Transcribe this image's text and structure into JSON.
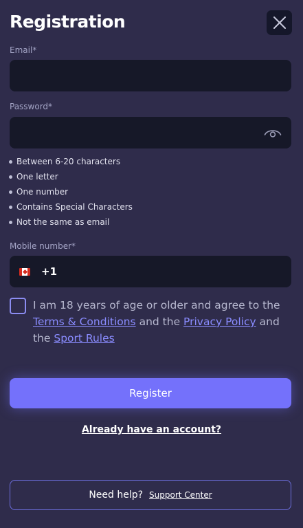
{
  "header": {
    "title": "Registration",
    "close_icon": "close-icon"
  },
  "email": {
    "label": "Email*",
    "value": "",
    "placeholder": ""
  },
  "password": {
    "label": "Password*",
    "value": "",
    "placeholder": "",
    "toggle_icon": "eye-icon",
    "rules": [
      "Between 6-20 characters",
      "One letter",
      "One number",
      "Contains Special Characters",
      "Not the same as email"
    ]
  },
  "mobile": {
    "label": "Mobile number*",
    "country_icon": "canada-flag-icon",
    "dial_code": "+1",
    "value": ""
  },
  "agreement": {
    "checked": false,
    "text_1": "I am 18 years of age or older and agree to the",
    "link_terms": "Terms & Conditions",
    "text_2": "and the",
    "link_privacy": "Privacy Policy",
    "text_3": "and the",
    "link_sport_rules": "Sport Rules"
  },
  "actions": {
    "register_label": "Register",
    "signin_link": "Already have an account?"
  },
  "help": {
    "text": "Need help?",
    "link": "Support Center"
  },
  "colors": {
    "background": "#2f2c4b",
    "field_background": "#161828",
    "accent": "#7471fb",
    "link": "#8a8cff"
  }
}
